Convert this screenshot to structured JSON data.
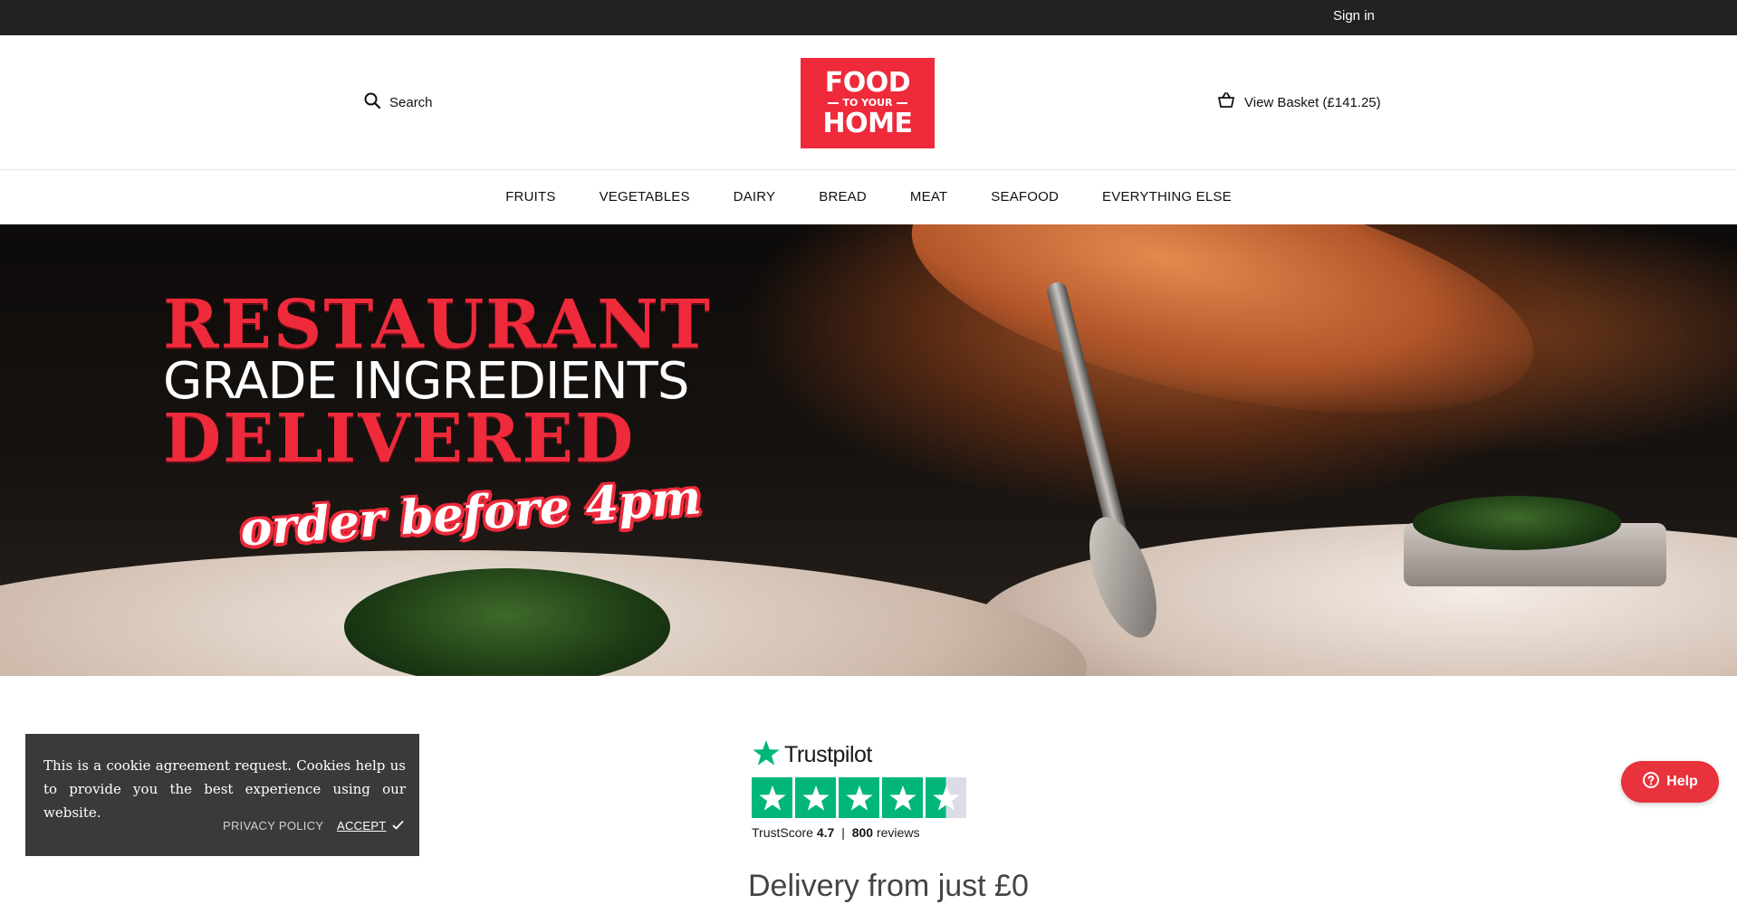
{
  "topbar": {
    "signin_label": "Sign in"
  },
  "header": {
    "search_label": "Search",
    "logo": {
      "line1": "FOOD",
      "line2": "TO YOUR",
      "line3": "HOME"
    },
    "basket_label": "View Basket (£141.25)"
  },
  "nav": {
    "items": [
      "FRUITS",
      "VEGETABLES",
      "DAIRY",
      "BREAD",
      "MEAT",
      "SEAFOOD",
      "EVERYTHING ELSE"
    ]
  },
  "hero": {
    "line1": "RESTAURANT",
    "line2": "GRADE INGREDIENTS",
    "line3": "DELIVERED",
    "line4": "order before 4pm"
  },
  "trustpilot": {
    "brand": "Trustpilot",
    "score_label": "TrustScore",
    "score": "4.7",
    "separator": "|",
    "reviews_count": "800",
    "reviews_label": "reviews",
    "rating": 4.5
  },
  "section": {
    "partial_heading": "Delivery from just £0"
  },
  "cookie": {
    "text": "This is a cookie agreement request. Cookies help us to provide you the best experience using our website.",
    "privacy_label": "PRIVACY POLICY",
    "accept_label": "ACCEPT"
  },
  "help": {
    "label": "Help"
  },
  "colors": {
    "brand_red": "#ee2a3b",
    "topbar": "#222222",
    "trustpilot_green": "#00b67a",
    "cookie_bg": "#3a3a3a"
  }
}
